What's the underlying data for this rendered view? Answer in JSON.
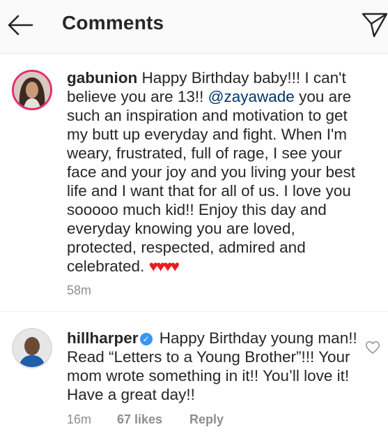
{
  "header": {
    "title": "Comments",
    "back_icon": "arrow-left-icon",
    "share_icon": "paper-plane-icon"
  },
  "comments": [
    {
      "username": "gabunion",
      "text_part1": "Happy Birthday baby!!! I can't believe you are 13!! ",
      "mention": "@zayawade",
      "text_part2": " you are such an inspiration and motivation to get my butt up everyday and fight. When I'm weary, frustrated, full of rage, I see your face and your joy and you living your best life and I want that for all of us. I love you sooooo much kid!! Enjoy this day and everyday knowing you are loved, protected, respected, admired and celebrated. ",
      "emoji": "♥♥♥♥",
      "time": "58m",
      "avatar_icon": "profile-photo-avatar"
    },
    {
      "username": "hillharper",
      "verified_icon": "verified-badge-icon",
      "text": "Happy Birthday young man!! Read “Letters to a Young Brother”!!! Your mom wrote something in it!! You’ll love it! Have a great day!!",
      "time": "16m",
      "likes": "67 likes",
      "reply": "Reply",
      "like_icon": "heart-outline-icon",
      "avatar_icon": "profile-photo-avatar"
    }
  ],
  "colors": {
    "text": "#262626",
    "muted": "#8e8e8e",
    "mention": "#00376b",
    "verified": "#3897f0",
    "heart": "#ed1c24",
    "story_ring": "#e1306c"
  }
}
